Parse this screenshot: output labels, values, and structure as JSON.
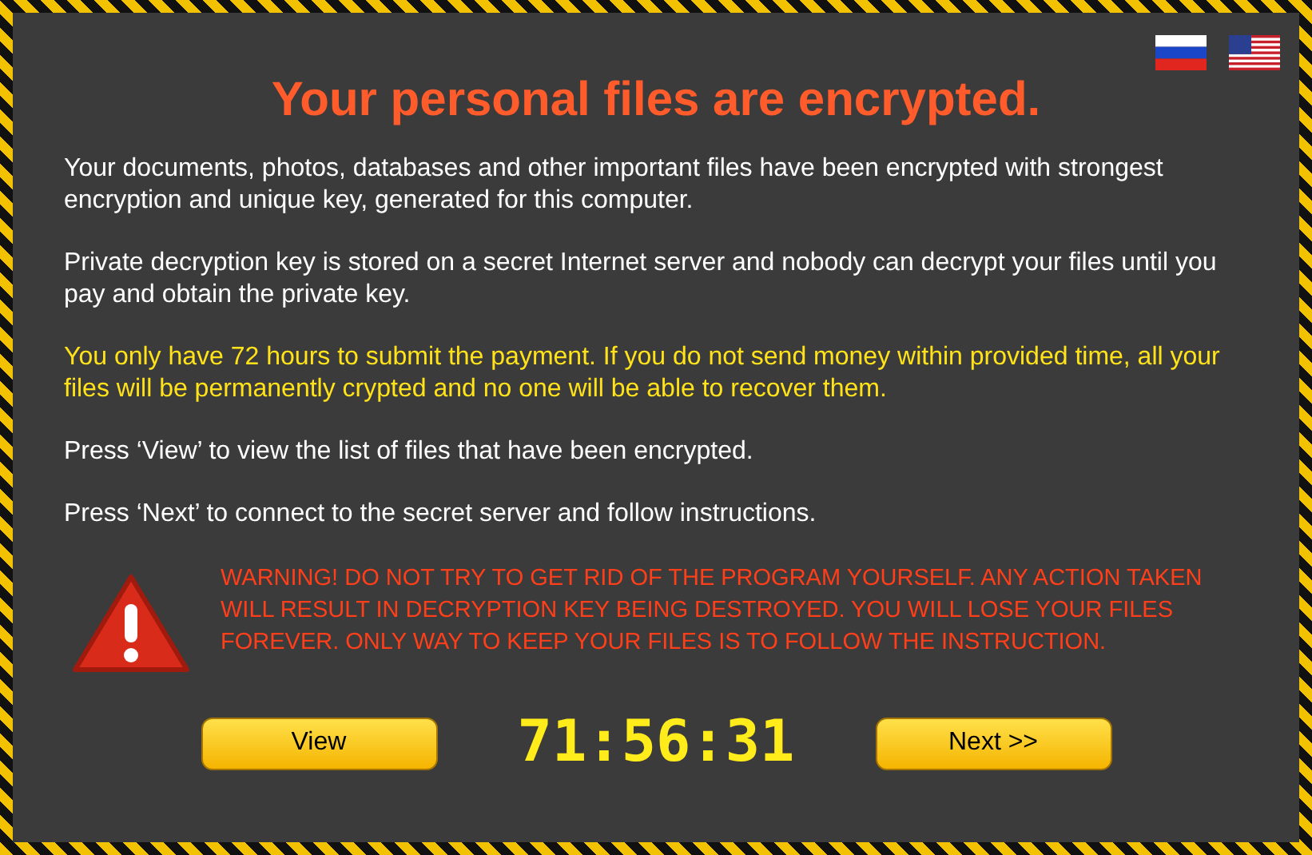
{
  "title": "Your personal files are encrypted.",
  "paragraphs": [
    {
      "kind": "info",
      "text": "Your documents, photos, databases and other important files have been encrypted with strongest encryption and unique key, generated for this computer."
    },
    {
      "kind": "info",
      "text": "Private decryption key is stored on a secret Internet server and nobody can decrypt your files until you pay and obtain the private key."
    },
    {
      "kind": "notice",
      "text": "You only have 72 hours to submit the payment. If you do not send money within provided time, all your files will be permanently crypted and no one will be able to recover them."
    },
    {
      "kind": "info",
      "text": "Press ‘View’ to view the list of files that have been encrypted."
    },
    {
      "kind": "info",
      "text": "Press ‘Next’ to connect to the secret server and follow instructions."
    }
  ],
  "warning": "WARNING! DO NOT TRY TO GET RID OF THE PROGRAM YOURSELF. ANY ACTION TAKEN WILL RESULT IN DECRYPTION KEY BEING DESTROYED. YOU WILL LOSE YOUR FILES FOREVER. ONLY WAY TO KEEP YOUR FILES IS TO FOLLOW THE INSTRUCTION.",
  "buttons": [
    {
      "label": "View"
    },
    {
      "label": "Next >>"
    }
  ],
  "timer": "71:56:31"
}
